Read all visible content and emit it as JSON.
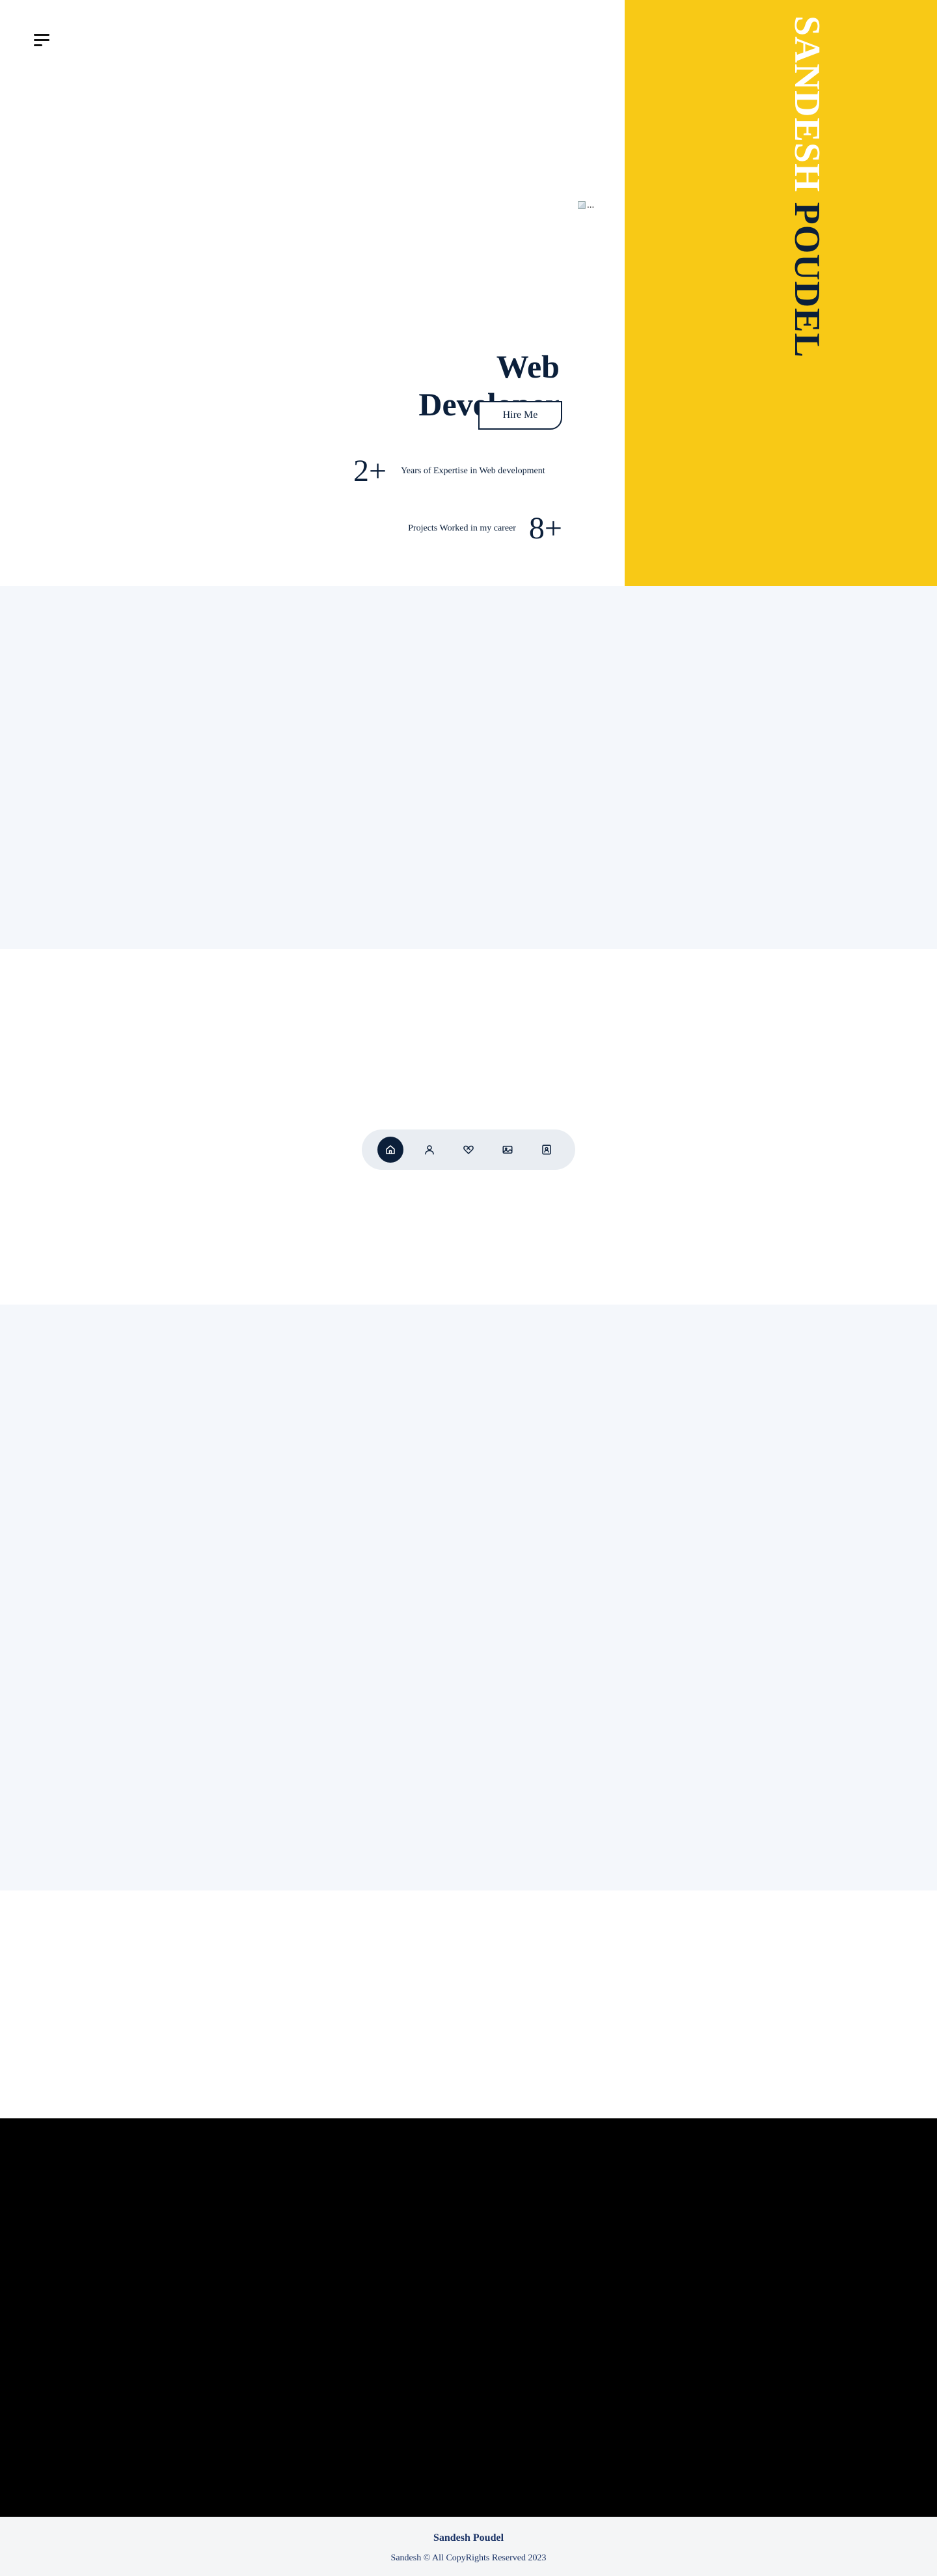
{
  "hero": {
    "name_first": "SANDESH",
    "name_last": "POUDEL",
    "image_alt": "...",
    "role": "Web Developer",
    "hire_label": "Hire Me",
    "stats": [
      {
        "value": "2+",
        "label": "Years of Expertise in Web development"
      },
      {
        "value": "8+",
        "label": "Projects Worked in my career"
      }
    ]
  },
  "nav": {
    "menu_icon": "hamburger-menu-icon",
    "dock": [
      {
        "icon": "home-icon",
        "active": true
      },
      {
        "icon": "user-icon",
        "active": false
      },
      {
        "icon": "heart-handshake-icon",
        "active": false
      },
      {
        "icon": "image-gallery-icon",
        "active": false
      },
      {
        "icon": "contact-book-icon",
        "active": false
      }
    ]
  },
  "footer": {
    "name": "Sandesh Poudel",
    "copyright": "Sandesh © All CopyRights Reserved 2023"
  },
  "colors": {
    "accent_yellow": "#f8c916",
    "navy": "#0b1f3a",
    "section_light": "#f4f7fb",
    "footer_text": "#1b3366"
  }
}
